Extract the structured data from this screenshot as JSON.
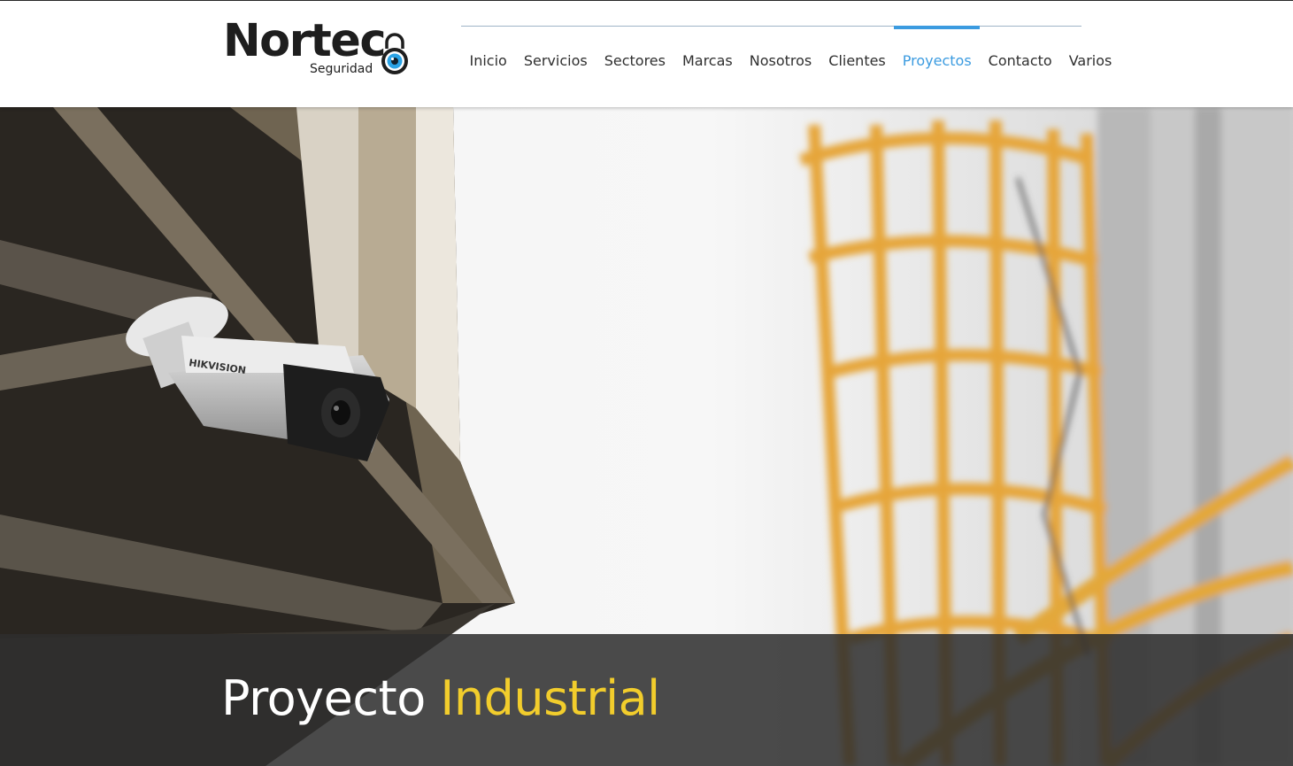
{
  "brand": {
    "name": "Nortec",
    "tagline": "Seguridad",
    "logo_icon": "lock-eye-icon",
    "accent_color": "#3b9be0"
  },
  "nav": {
    "items": [
      {
        "label": "Inicio",
        "active": false
      },
      {
        "label": "Servicios",
        "active": false
      },
      {
        "label": "Sectores",
        "active": false
      },
      {
        "label": "Marcas",
        "active": false
      },
      {
        "label": "Nosotros",
        "active": false
      },
      {
        "label": "Clientes",
        "active": false
      },
      {
        "label": "Proyectos",
        "active": true
      },
      {
        "label": "Contacto",
        "active": false
      },
      {
        "label": "Varios",
        "active": false
      }
    ]
  },
  "hero": {
    "camera_brand": "HIKVISION",
    "title_part1": "Proyecto",
    "title_part2": "Industrial",
    "title_highlight_color": "#f2cd2c"
  }
}
